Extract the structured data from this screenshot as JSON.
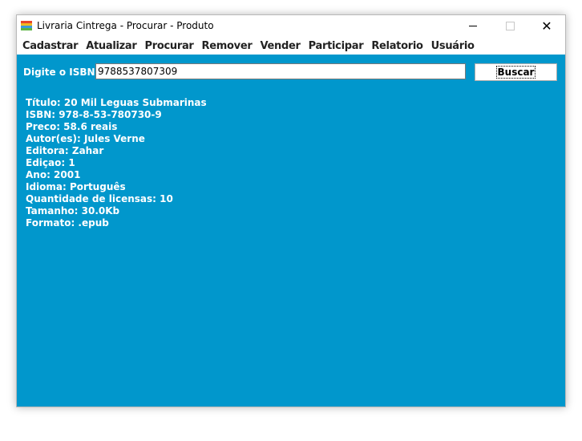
{
  "window": {
    "title": "Livraria Cintrega - Procurar - Produto",
    "controls": {
      "minimize": "",
      "maximize": "",
      "close": "✕"
    }
  },
  "menu": [
    "Cadastrar",
    "Atualizar",
    "Procurar",
    "Remover",
    "Vender",
    "Participar",
    "Relatorio",
    "Usuário"
  ],
  "search": {
    "label": "Digite o ISBN:",
    "value": "9788537807309",
    "button": "Buscar"
  },
  "details": {
    "titulo": "Título: 20 Mil Leguas Submarinas",
    "isbn": "ISBN: 978-8-53-780730-9",
    "preco": "Preco: 58.6 reais",
    "autores": "Autor(es): Jules Verne",
    "editora": "Editora: Zahar",
    "edicao": "Ediçao: 1",
    "ano": "Ano: 2001",
    "idioma": "Idioma: Português",
    "licensas": "Quantidade de licensas: 10",
    "tamanho": "Tamanho: 30.0Kb",
    "formato": "Formato: .epub"
  },
  "colors": {
    "content_bg": "#0197cc",
    "text_on_content": "#ffffff"
  }
}
